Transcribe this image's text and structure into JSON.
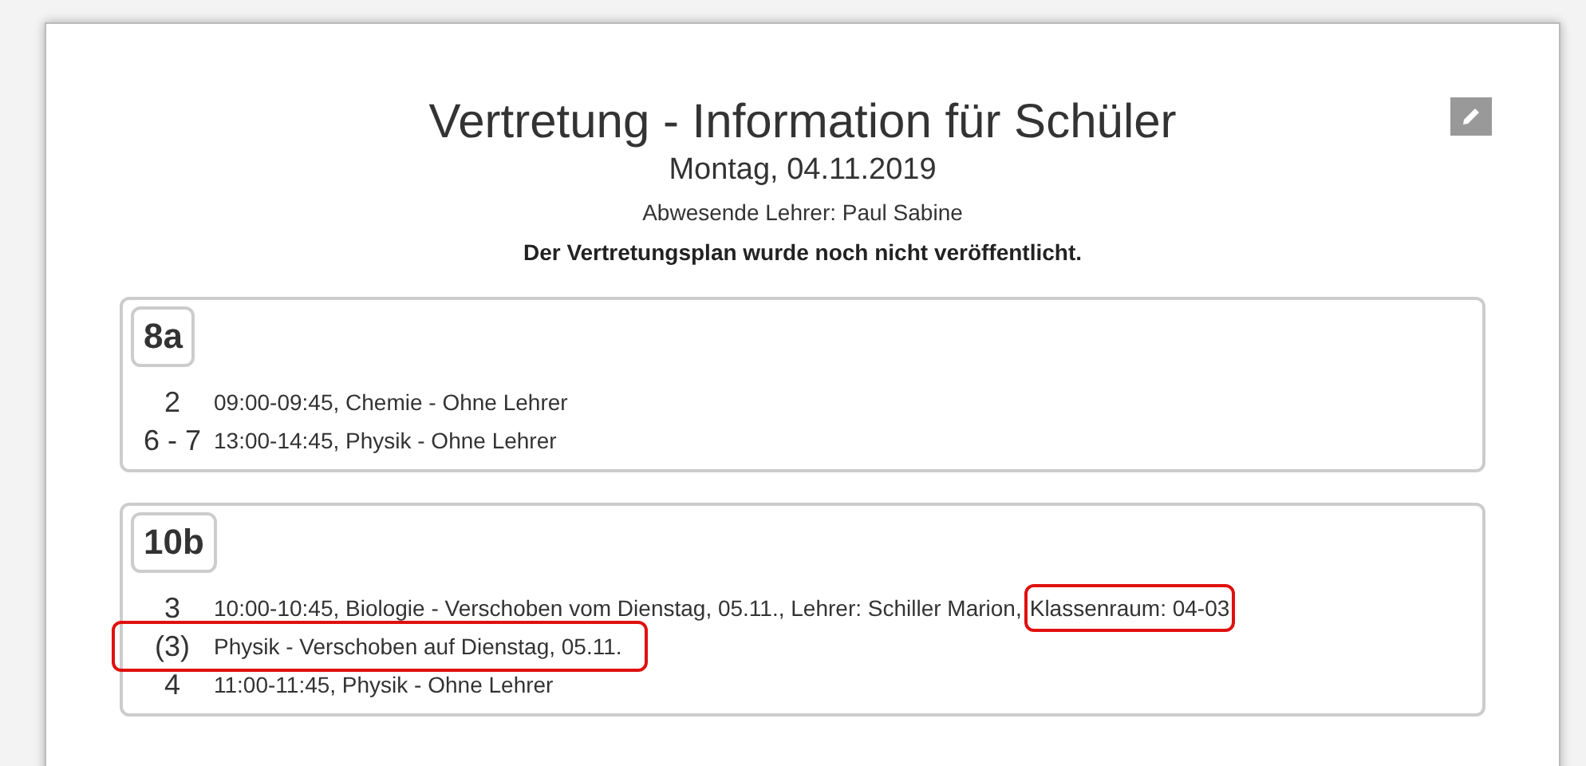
{
  "header": {
    "title": "Vertretung - Information für Schüler",
    "date": "Montag, 04.11.2019",
    "absent": "Abwesende Lehrer: Paul Sabine",
    "notice": "Der Vertretungsplan wurde noch nicht veröffentlicht."
  },
  "classes": [
    {
      "name": "8a",
      "rows": [
        {
          "period": "2",
          "text": "09:00-09:45, Chemie - Ohne Lehrer",
          "highlighted": false
        },
        {
          "period": "6 - 7",
          "text": "13:00-14:45, Physik - Ohne Lehrer",
          "highlighted": false
        }
      ]
    },
    {
      "name": "10b",
      "rows": [
        {
          "period": "3",
          "text": "10:00-10:45, Biologie - Verschoben vom Dienstag, 05.11., Lehrer: Schiller Marion,",
          "highlighted": false,
          "marked_text": "Klassenraum: 04-03"
        },
        {
          "period": "(3)",
          "text": "Physik - Verschoben auf Dienstag, 05.11.",
          "highlighted": true
        },
        {
          "period": "4",
          "text": "11:00-11:45, Physik - Ohne Lehrer",
          "highlighted": false
        }
      ]
    }
  ]
}
